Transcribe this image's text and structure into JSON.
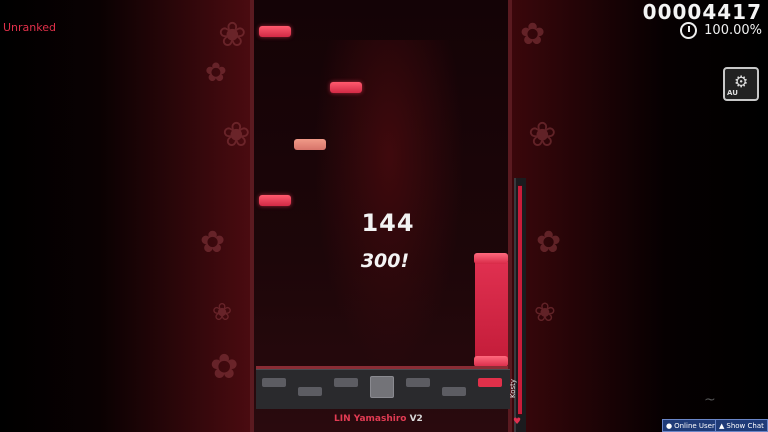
{
  "status": {
    "ranked_label": "Unranked"
  },
  "score": {
    "value": "00004417",
    "accuracy": "100.00%"
  },
  "play": {
    "combo": "144",
    "judgement": "300!"
  },
  "song": {
    "artist": "LIN Yamashiro",
    "version": "V2"
  },
  "player": {
    "name": "Kosty"
  },
  "mods": {
    "label": "AU"
  },
  "buttons": {
    "online_users": "Online Users",
    "show_chat": "Show Chat"
  },
  "icons": {
    "mod": "gear-icon",
    "accuracy": "clock-icon",
    "health": "heart-icon",
    "flower": "sakura-icon"
  },
  "colors": {
    "note": "#e23452",
    "judgeline": "#8a2c35",
    "stage_border": "#5a1a20",
    "accent": "#e0304a"
  }
}
